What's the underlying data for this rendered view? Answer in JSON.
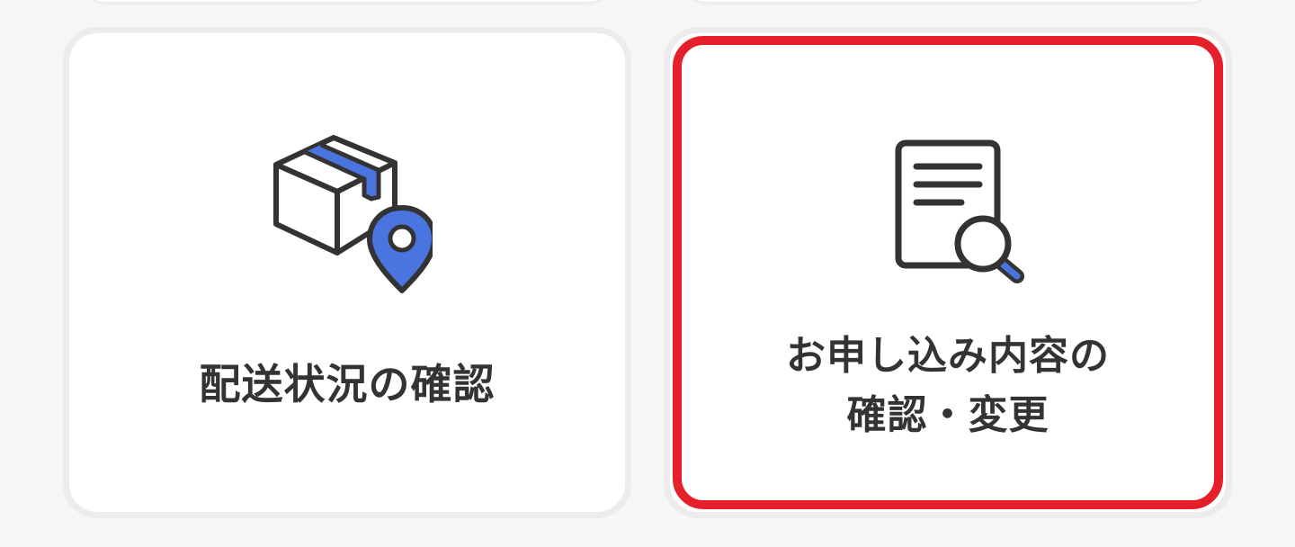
{
  "cards": [
    {
      "id": "delivery-status",
      "label_lines": [
        "配送状況の確認"
      ],
      "icon": "package-location-icon"
    },
    {
      "id": "application-details",
      "label_lines": [
        "お申し込み内容の",
        "確認・変更"
      ],
      "icon": "document-search-icon",
      "focused": true
    }
  ],
  "colors": {
    "accent_blue": "#4a74e0",
    "icon_stroke": "#333333",
    "focus_red": "#e5202a",
    "background": "#f6f6f6",
    "card_bg": "#ffffff"
  }
}
